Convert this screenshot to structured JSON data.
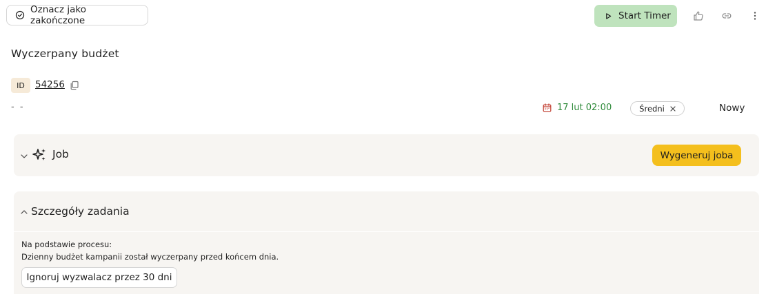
{
  "toolbar": {
    "mark_done_label": "Oznacz jako zakończone",
    "start_timer_label": "Start Timer",
    "icons": [
      "check-circle-icon",
      "play-icon",
      "thumbs-up-icon",
      "link-icon",
      "more-vertical-icon"
    ]
  },
  "task": {
    "title": "Wyczerpany budżet",
    "id_label": "ID",
    "id_value": "54256",
    "assignee_placeholder": "- -",
    "due_date": "17 lut 02:00",
    "priority": "Średni",
    "status": "Nowy"
  },
  "job_section": {
    "title": "Job",
    "generate_label": "Wygeneruj joba"
  },
  "details_section": {
    "title": "Szczegóły zadania",
    "process_label": "Na podstawie procesu:",
    "process_description": "Dzienny budżet kampanii został wyczerpany przed końcem dnia.",
    "ignore_label": "Ignoruj wyzwalacz przez 30 dni"
  },
  "colors": {
    "start_timer_bg": "#bfe3bd",
    "generate_bg": "#f4bf1d",
    "due_date_text": "#2e8a3a",
    "calendar_icon": "#c0392b",
    "id_badge_bg": "#f6ead8",
    "panel_bg": "#f7f5f2"
  }
}
